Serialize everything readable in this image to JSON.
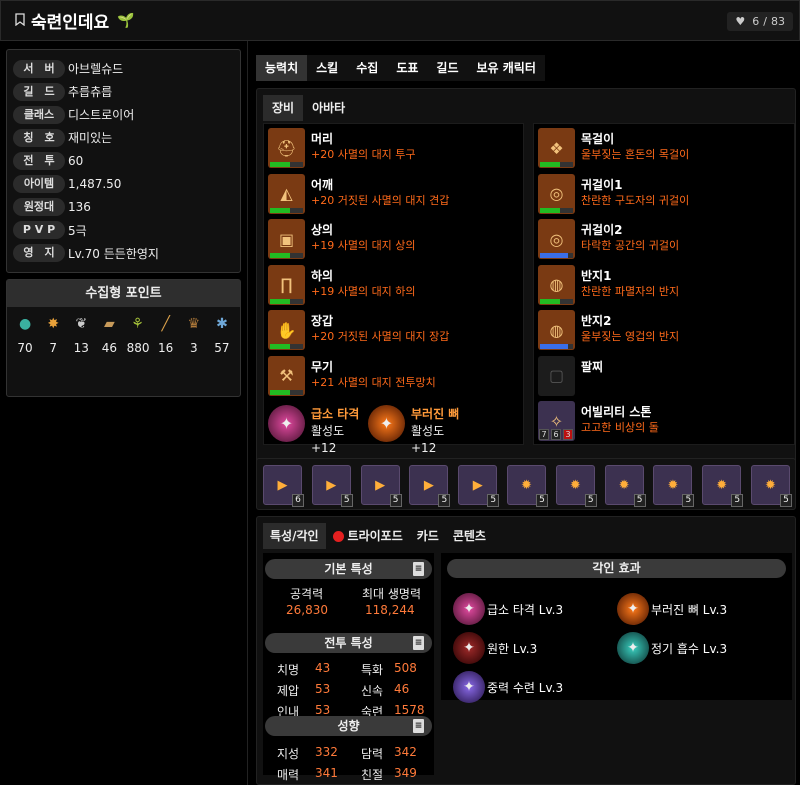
{
  "header": {
    "title": "숙련인데요",
    "likes": "6",
    "likes_total": "83"
  },
  "profile": [
    {
      "label": "서　버",
      "value": "아브렐슈드"
    },
    {
      "label": "길　드",
      "value": "추릅츄릅"
    },
    {
      "label": "클래스",
      "value": "디스트로이어"
    },
    {
      "label": "칭　호",
      "value": "재미있는"
    },
    {
      "label": "전　투",
      "value": "60"
    },
    {
      "label": "아이템",
      "value": "1,487.50"
    },
    {
      "label": "원정대",
      "value": "136"
    },
    {
      "label": "P V P",
      "value": "5극"
    },
    {
      "label": "영　지",
      "value": "Lv.70 든든한영지"
    }
  ],
  "collect": {
    "title": "수집형 포인트",
    "values": [
      "70",
      "7",
      "13",
      "46",
      "880",
      "16",
      "3",
      "57"
    ],
    "icons": [
      "island-heart-icon",
      "giant-heart-icon",
      "art-icon",
      "map-icon",
      "mokoko-seed-icon",
      "orpheus-star-icon",
      "mask-icon",
      "world-tree-leaf-icon"
    ],
    "colors": [
      "#3ab0a0",
      "#e8a13a",
      "#cccccc",
      "#c79a5a",
      "#a5c23a",
      "#d9a04a",
      "#b07a3a",
      "#6fa8d8"
    ]
  },
  "tabs": [
    "능력치",
    "스킬",
    "수집",
    "도표",
    "길드",
    "보유 캐릭터"
  ],
  "subtabs": [
    "장비",
    "아바타"
  ],
  "equip_left": [
    {
      "name": "머리",
      "desc": "+20 사멸의 대지 투구",
      "quality": 0.6
    },
    {
      "name": "어깨",
      "desc": "+20 거짓된 사멸의 대지 견갑",
      "quality": 0.6
    },
    {
      "name": "상의",
      "desc": "+19 사멸의 대지 상의",
      "quality": 0.6
    },
    {
      "name": "하의",
      "desc": "+19 사멸의 대지 하의",
      "quality": 0.6
    },
    {
      "name": "장갑",
      "desc": "+20 거짓된 사멸의 대지 장갑",
      "quality": 0.6
    },
    {
      "name": "무기",
      "desc": "+21 사멸의 대지 전투망치",
      "quality": 0.6
    }
  ],
  "gems": [
    {
      "name": "급소 타격",
      "val": "활성도 +12"
    },
    {
      "name": "부러진 뼈",
      "val": "활성도 +12"
    }
  ],
  "equip_right": [
    {
      "name": "목걸이",
      "desc": "울부짖는 혼돈의 목걸이",
      "quality": 0.6,
      "bar": "#22bb22"
    },
    {
      "name": "귀걸이1",
      "desc": "찬란한 구도자의 귀걸이",
      "quality": 0.6,
      "bar": "#22bb22"
    },
    {
      "name": "귀걸이2",
      "desc": "타락한 공간의 귀걸이",
      "quality": 0.85,
      "bar": "#3a6ee8"
    },
    {
      "name": "반지1",
      "desc": "찬란한 파멸자의 반지",
      "quality": 0.6,
      "bar": "#22bb22"
    },
    {
      "name": "반지2",
      "desc": "울부짖는 영겁의 반지",
      "quality": 0.85,
      "bar": "#3a6ee8"
    },
    {
      "name": "팔찌",
      "desc": "",
      "quality": 0,
      "bar": "#333333"
    },
    {
      "name": "어빌리티 스톤",
      "desc": "고고한 비상의 돌",
      "quality": 0,
      "bar": "#333333"
    }
  ],
  "stone_levels": [
    "7",
    "6",
    "3"
  ],
  "cards": [
    "6",
    "5",
    "5",
    "5",
    "5",
    "5",
    "5",
    "5",
    "5",
    "5",
    "5"
  ],
  "stat_tabs": [
    "특성/각인",
    "트라이포드",
    "카드",
    "콘텐츠"
  ],
  "basic": {
    "title": "기본 특성",
    "attack_label": "공격력",
    "attack": "26,830",
    "hp_label": "최대 생명력",
    "hp": "118,244"
  },
  "combat": {
    "title": "전투 특성",
    "rows": [
      {
        "l": "치명",
        "v": "43",
        "l2": "특화",
        "v2": "508"
      },
      {
        "l": "제압",
        "v": "53",
        "l2": "신속",
        "v2": "46"
      },
      {
        "l": "인내",
        "v": "53",
        "l2": "숙련",
        "v2": "1578"
      }
    ]
  },
  "tendency": {
    "title": "성향",
    "rows": [
      {
        "l": "지성",
        "v": "332",
        "l2": "담력",
        "v2": "342"
      },
      {
        "l": "매력",
        "v": "341",
        "l2": "친절",
        "v2": "349"
      }
    ]
  },
  "engraving": {
    "title": "각인 효과",
    "items": [
      "급소 타격 Lv.3",
      "부러진 뼈 Lv.3",
      "원한 Lv.3",
      "정기 흡수 Lv.3",
      "중력 수련 Lv.3"
    ]
  }
}
